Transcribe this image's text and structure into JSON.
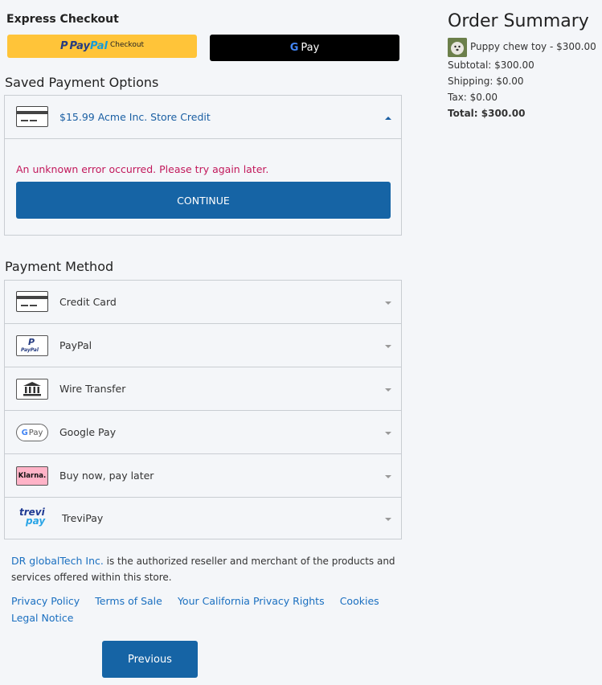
{
  "express": {
    "heading": "Express Checkout",
    "paypal": {
      "brand_pay": "Pay",
      "brand_pal": "Pal",
      "suffix": "Checkout"
    },
    "gpay": {
      "label": "Pay"
    }
  },
  "saved": {
    "heading": "Saved Payment Options",
    "option_label": "$15.99 Acme Inc. Store Credit",
    "error": "An unknown error occurred. Please try again later.",
    "continue_label": "CONTINUE"
  },
  "payment": {
    "heading": "Payment Method",
    "methods": [
      {
        "label": "Credit Card",
        "icon": "credit-card-icon"
      },
      {
        "label": "PayPal",
        "icon": "paypal-icon"
      },
      {
        "label": "Wire Transfer",
        "icon": "bank-icon"
      },
      {
        "label": "Google Pay",
        "icon": "google-pay-icon"
      },
      {
        "label": "Buy now, pay later",
        "icon": "klarna-icon"
      },
      {
        "label": "TreviPay",
        "icon": "trevipay-icon"
      }
    ]
  },
  "summary": {
    "title": "Order Summary",
    "item": "Puppy chew toy - $300.00",
    "subtotal": "Subtotal: $300.00",
    "shipping": "Shipping: $0.00",
    "tax": "Tax: $0.00",
    "total": "Total: $300.00"
  },
  "footer": {
    "company_link": "DR globalTech Inc.",
    "text": " is the authorized reseller and merchant of the products and services offered within this store.",
    "links": [
      "Privacy Policy",
      "Terms of Sale",
      "Your California Privacy Rights",
      "Cookies",
      "Legal Notice"
    ]
  },
  "nav": {
    "previous_label": "Previous"
  },
  "icons": {
    "paypal_mini": "PayPal",
    "gpay_mini": "Pay",
    "klarna": "Klarna.",
    "trevi_top": "trevi",
    "trevi_bottom": "pay"
  },
  "colors": {
    "accent": "#1664a5",
    "error": "#c2185b",
    "paypal_yellow": "#ffc439",
    "link": "#1a6fc0"
  }
}
